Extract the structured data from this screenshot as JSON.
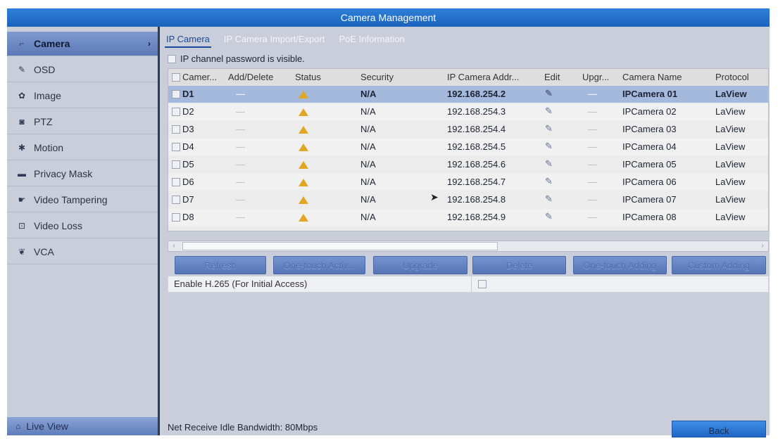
{
  "window": {
    "title": "Camera Management"
  },
  "sidebar": {
    "items": [
      {
        "label": "Camera",
        "icon": "camera-icon",
        "glyph": "⌐",
        "active": true
      },
      {
        "label": "OSD",
        "icon": "osd-icon",
        "glyph": "✎"
      },
      {
        "label": "Image",
        "icon": "image-icon",
        "glyph": "✿"
      },
      {
        "label": "PTZ",
        "icon": "ptz-icon",
        "glyph": "◙"
      },
      {
        "label": "Motion",
        "icon": "motion-icon",
        "glyph": "✱"
      },
      {
        "label": "Privacy Mask",
        "icon": "privacy-mask-icon",
        "glyph": "▬"
      },
      {
        "label": "Video Tampering",
        "icon": "video-tampering-icon",
        "glyph": "☛"
      },
      {
        "label": "Video Loss",
        "icon": "video-loss-icon",
        "glyph": "⊡"
      },
      {
        "label": "VCA",
        "icon": "vca-icon",
        "glyph": "❦"
      }
    ],
    "live_view": {
      "label": "Live View",
      "icon": "home-icon",
      "glyph": "⌂"
    }
  },
  "tabs": [
    {
      "label": "IP Camera",
      "active": true
    },
    {
      "label": "IP Camera Import/Export"
    },
    {
      "label": "PoE Information"
    }
  ],
  "password_visible": {
    "label": "IP channel password is visible.",
    "checked": false
  },
  "table": {
    "columns": [
      "Camer...",
      "Add/Delete",
      "Status",
      "Security",
      "IP Camera Addr...",
      "Edit",
      "Upgr...",
      "Camera Name",
      "Protocol"
    ],
    "rows": [
      {
        "camera": "D1",
        "add_delete": "—",
        "status": "warning",
        "security": "N/A",
        "ip": "192.168.254.2",
        "edit": "✎",
        "upgrade": "—",
        "name": "IPCamera 01",
        "protocol": "LaView",
        "selected": true
      },
      {
        "camera": "D2",
        "add_delete": "—",
        "status": "warning",
        "security": "N/A",
        "ip": "192.168.254.3",
        "edit": "✎",
        "upgrade": "—",
        "name": "IPCamera 02",
        "protocol": "LaView"
      },
      {
        "camera": "D3",
        "add_delete": "—",
        "status": "warning",
        "security": "N/A",
        "ip": "192.168.254.4",
        "edit": "✎",
        "upgrade": "—",
        "name": "IPCamera 03",
        "protocol": "LaView"
      },
      {
        "camera": "D4",
        "add_delete": "—",
        "status": "warning",
        "security": "N/A",
        "ip": "192.168.254.5",
        "edit": "✎",
        "upgrade": "—",
        "name": "IPCamera 04",
        "protocol": "LaView"
      },
      {
        "camera": "D5",
        "add_delete": "—",
        "status": "warning",
        "security": "N/A",
        "ip": "192.168.254.6",
        "edit": "✎",
        "upgrade": "—",
        "name": "IPCamera 05",
        "protocol": "LaView"
      },
      {
        "camera": "D6",
        "add_delete": "—",
        "status": "warning",
        "security": "N/A",
        "ip": "192.168.254.7",
        "edit": "✎",
        "upgrade": "—",
        "name": "IPCamera 06",
        "protocol": "LaView"
      },
      {
        "camera": "D7",
        "add_delete": "—",
        "status": "warning",
        "security": "N/A",
        "ip": "192.168.254.8",
        "edit": "✎",
        "upgrade": "—",
        "name": "IPCamera 07",
        "protocol": "LaView"
      },
      {
        "camera": "D8",
        "add_delete": "—",
        "status": "warning",
        "security": "N/A",
        "ip": "192.168.254.9",
        "edit": "✎",
        "upgrade": "—",
        "name": "IPCamera 08",
        "protocol": "LaView"
      }
    ]
  },
  "scrollbar": {
    "left_arrow": "‹",
    "right_arrow": "›"
  },
  "buttons": {
    "refresh": "Refresh",
    "one_touch_activate": "One-touch Activ...",
    "upgrade": "Upgrade",
    "delete": "Delete",
    "one_touch_adding": "One-touch Adding",
    "custom_adding": "Custom Adding"
  },
  "h265": {
    "label": "Enable H.265 (For Initial Access)",
    "checked": false
  },
  "status": {
    "bandwidth": "Net Receive Idle Bandwidth: 80Mbps"
  },
  "back": {
    "label": "Back"
  },
  "cursor": {
    "glyph": "➤"
  },
  "colors": {
    "accent": "#1b63bd",
    "selected_row": "#a5b9dd",
    "warning": "#e2a722"
  }
}
